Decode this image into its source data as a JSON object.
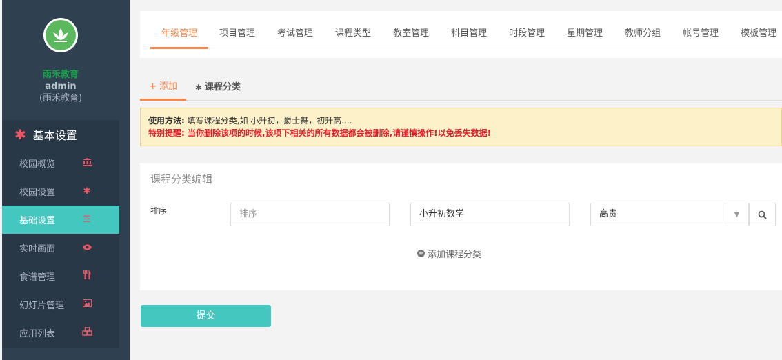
{
  "sidebar": {
    "org_name": "雨禾教育",
    "username": "admin",
    "org_sub": "(雨禾教育)",
    "section_title": "基本设置",
    "items": [
      {
        "label": "校园概览",
        "icon": "bank-icon"
      },
      {
        "label": "校园设置",
        "icon": "gear-icon"
      },
      {
        "label": "基础设置",
        "icon": "list-icon",
        "active": true
      },
      {
        "label": "实时画面",
        "icon": "eye-icon"
      },
      {
        "label": "食谱管理",
        "icon": "cutlery-icon"
      },
      {
        "label": "幻灯片管理",
        "icon": "picture-icon"
      },
      {
        "label": "应用列表",
        "icon": "cubes-icon"
      }
    ]
  },
  "top_tabs": [
    "年级管理",
    "项目管理",
    "考试管理",
    "课程类型",
    "教室管理",
    "科目管理",
    "时段管理",
    "星期管理",
    "教师分组",
    "帐号管理",
    "模板管理"
  ],
  "sub_tabs": {
    "add": "添加",
    "category": "课程分类"
  },
  "notice": {
    "usage_label": "使用方法:",
    "usage_text": "填写课程分类,如 小升初，爵士舞，初升高....",
    "warning": "特别提醒: 当你删除该项的时候,该项下相关的所有数据都会被删除,请谨慎操作!以免丢失数据!"
  },
  "form": {
    "title": "课程分类编辑",
    "sort_label": "排序",
    "sort_placeholder": "排序",
    "name_value": "小升初数学",
    "level_value": "高贵",
    "add_category": "添加课程分类"
  },
  "submit_label": "提交",
  "colors": {
    "sidebar_bg": "#2f4050",
    "accent_teal": "#43c7bf",
    "accent_orange": "#f8864a",
    "icon_red": "#ed5565",
    "warning_red": "#e0202b"
  }
}
